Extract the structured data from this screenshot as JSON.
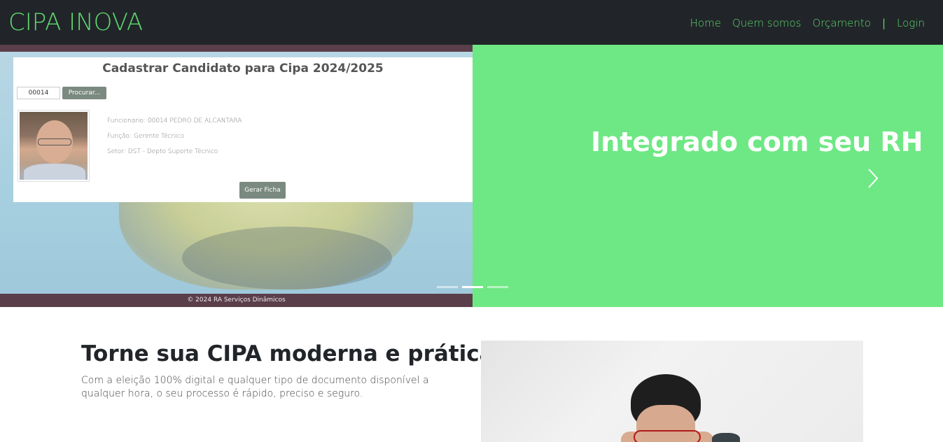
{
  "brand": "CIPA INOVA",
  "nav": {
    "home": "Home",
    "about": "Quem somos",
    "quote": "Orçamento",
    "separator": "|",
    "login": "Login"
  },
  "hero": {
    "caption": "Integrado com seu RH",
    "active_slide": 2,
    "slide_count": 3,
    "screenshot": {
      "title": "Cadastrar Candidato para Cipa 2024/2025",
      "search_value": "00014",
      "search_button": "Procurar...",
      "employee_line": "Funcionario: 00014 PEDRO DE ALCANTARA",
      "function_line": "Função: Gerente Técnico",
      "sector_line": "Setor: DST - Depto Suporte Técnico",
      "generate_button": "Gerar Ficha",
      "footer": "© 2024 RA Serviços Dinâmicos"
    }
  },
  "feature": {
    "title": "Torne sua CIPA moderna e prática",
    "text": "Com a eleição 100% digital e qualquer tipo de documento disponível a qualquer hora, o seu processo é rápido, preciso e seguro."
  },
  "colors": {
    "navbar_bg": "#212529",
    "brand_green": "#5fd96f",
    "hero_green": "#6ee884"
  },
  "icons": {
    "next": "chevron-right-icon"
  }
}
